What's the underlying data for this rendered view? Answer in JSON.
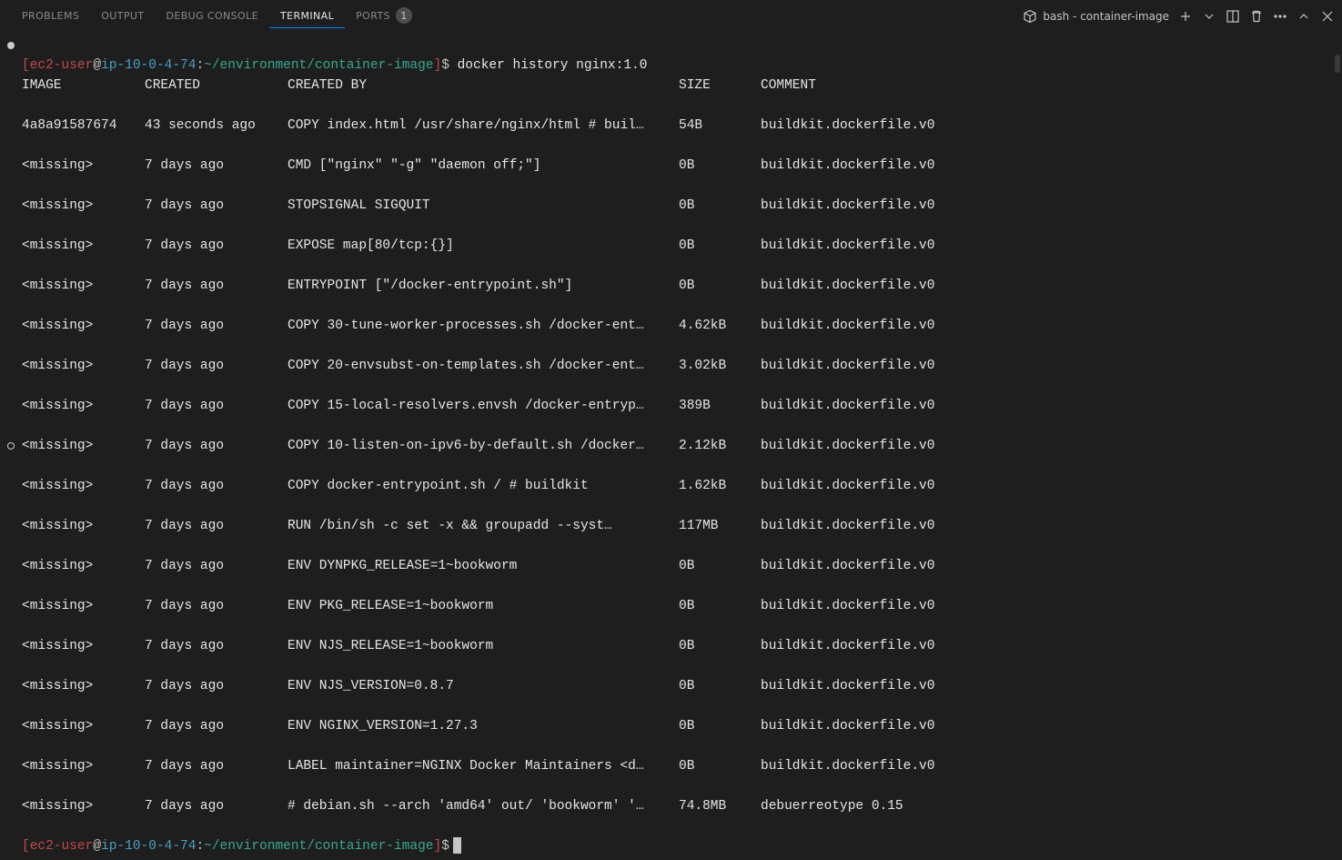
{
  "tabs": {
    "problems": "PROBLEMS",
    "output": "OUTPUT",
    "debug_console": "DEBUG CONSOLE",
    "terminal": "TERMINAL",
    "ports": "PORTS",
    "ports_badge": "1"
  },
  "header": {
    "shell_label": "bash - container-image"
  },
  "prompt": {
    "open": "[",
    "user": "ec2-user",
    "at": "@",
    "host": "ip-10-0-4-74",
    "colon": ":",
    "path": "~/environment/container-image",
    "close": "]",
    "sigil": "$"
  },
  "command": " docker history nginx:1.0",
  "columns": {
    "image": "IMAGE",
    "created": "CREATED",
    "created_by": "CREATED BY",
    "size": "SIZE",
    "comment": "COMMENT"
  },
  "rows": [
    {
      "image": "4a8a91587674",
      "created": "43 seconds ago",
      "by": "COPY index.html /usr/share/nginx/html # buil…",
      "size": "54B",
      "comment": "buildkit.dockerfile.v0"
    },
    {
      "image": "<missing>",
      "created": "7 days ago",
      "by": "CMD [\"nginx\" \"-g\" \"daemon off;\"]",
      "size": "0B",
      "comment": "buildkit.dockerfile.v0"
    },
    {
      "image": "<missing>",
      "created": "7 days ago",
      "by": "STOPSIGNAL SIGQUIT",
      "size": "0B",
      "comment": "buildkit.dockerfile.v0"
    },
    {
      "image": "<missing>",
      "created": "7 days ago",
      "by": "EXPOSE map[80/tcp:{}]",
      "size": "0B",
      "comment": "buildkit.dockerfile.v0"
    },
    {
      "image": "<missing>",
      "created": "7 days ago",
      "by": "ENTRYPOINT [\"/docker-entrypoint.sh\"]",
      "size": "0B",
      "comment": "buildkit.dockerfile.v0"
    },
    {
      "image": "<missing>",
      "created": "7 days ago",
      "by": "COPY 30-tune-worker-processes.sh /docker-ent…",
      "size": "4.62kB",
      "comment": "buildkit.dockerfile.v0"
    },
    {
      "image": "<missing>",
      "created": "7 days ago",
      "by": "COPY 20-envsubst-on-templates.sh /docker-ent…",
      "size": "3.02kB",
      "comment": "buildkit.dockerfile.v0"
    },
    {
      "image": "<missing>",
      "created": "7 days ago",
      "by": "COPY 15-local-resolvers.envsh /docker-entryp…",
      "size": "389B",
      "comment": "buildkit.dockerfile.v0"
    },
    {
      "image": "<missing>",
      "created": "7 days ago",
      "by": "COPY 10-listen-on-ipv6-by-default.sh /docker…",
      "size": "2.12kB",
      "comment": "buildkit.dockerfile.v0"
    },
    {
      "image": "<missing>",
      "created": "7 days ago",
      "by": "COPY docker-entrypoint.sh / # buildkit",
      "size": "1.62kB",
      "comment": "buildkit.dockerfile.v0"
    },
    {
      "image": "<missing>",
      "created": "7 days ago",
      "by": "RUN /bin/sh -c set -x     && groupadd --syst…",
      "size": "117MB",
      "comment": "buildkit.dockerfile.v0"
    },
    {
      "image": "<missing>",
      "created": "7 days ago",
      "by": "ENV DYNPKG_RELEASE=1~bookworm",
      "size": "0B",
      "comment": "buildkit.dockerfile.v0"
    },
    {
      "image": "<missing>",
      "created": "7 days ago",
      "by": "ENV PKG_RELEASE=1~bookworm",
      "size": "0B",
      "comment": "buildkit.dockerfile.v0"
    },
    {
      "image": "<missing>",
      "created": "7 days ago",
      "by": "ENV NJS_RELEASE=1~bookworm",
      "size": "0B",
      "comment": "buildkit.dockerfile.v0"
    },
    {
      "image": "<missing>",
      "created": "7 days ago",
      "by": "ENV NJS_VERSION=0.8.7",
      "size": "0B",
      "comment": "buildkit.dockerfile.v0"
    },
    {
      "image": "<missing>",
      "created": "7 days ago",
      "by": "ENV NGINX_VERSION=1.27.3",
      "size": "0B",
      "comment": "buildkit.dockerfile.v0"
    },
    {
      "image": "<missing>",
      "created": "7 days ago",
      "by": "LABEL maintainer=NGINX Docker Maintainers <d…",
      "size": "0B",
      "comment": "buildkit.dockerfile.v0"
    },
    {
      "image": "<missing>",
      "created": "7 days ago",
      "by": "# debian.sh --arch 'amd64' out/ 'bookworm' '…",
      "size": "74.8MB",
      "comment": "debuerreotype 0.15"
    }
  ]
}
